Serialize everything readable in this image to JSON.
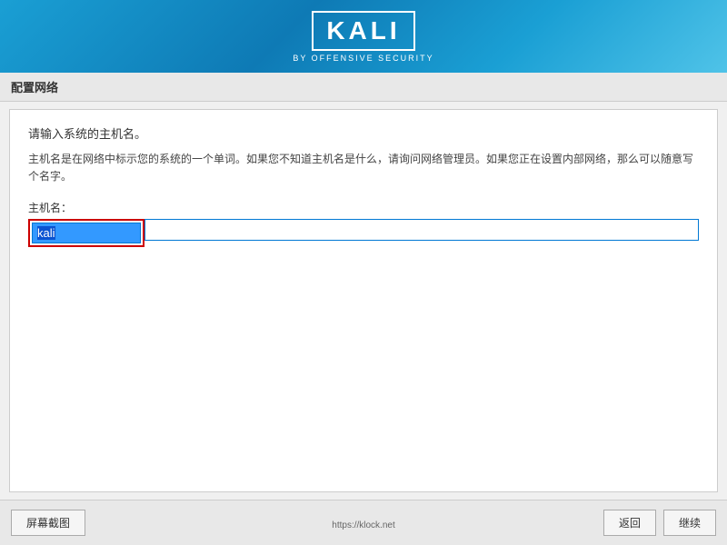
{
  "header": {
    "logo_text": "KALI",
    "sub_text": "BY OFFENSIVE SECURITY"
  },
  "page_title": "配置网络",
  "main": {
    "instruction_title": "请输入系统的主机名。",
    "instruction_body": "主机名是在网络中标示您的系统的一个单词。如果您不知道主机名是什么，请询问网络管理员。如果您正在设置内部网络，那么可以随意写个名字。",
    "field_label": "主机名：",
    "hostname_value": "kali"
  },
  "footer": {
    "screenshot_btn": "屏幕截图",
    "back_btn": "返回",
    "continue_btn": "继续",
    "url_text": "https://klock.net"
  }
}
